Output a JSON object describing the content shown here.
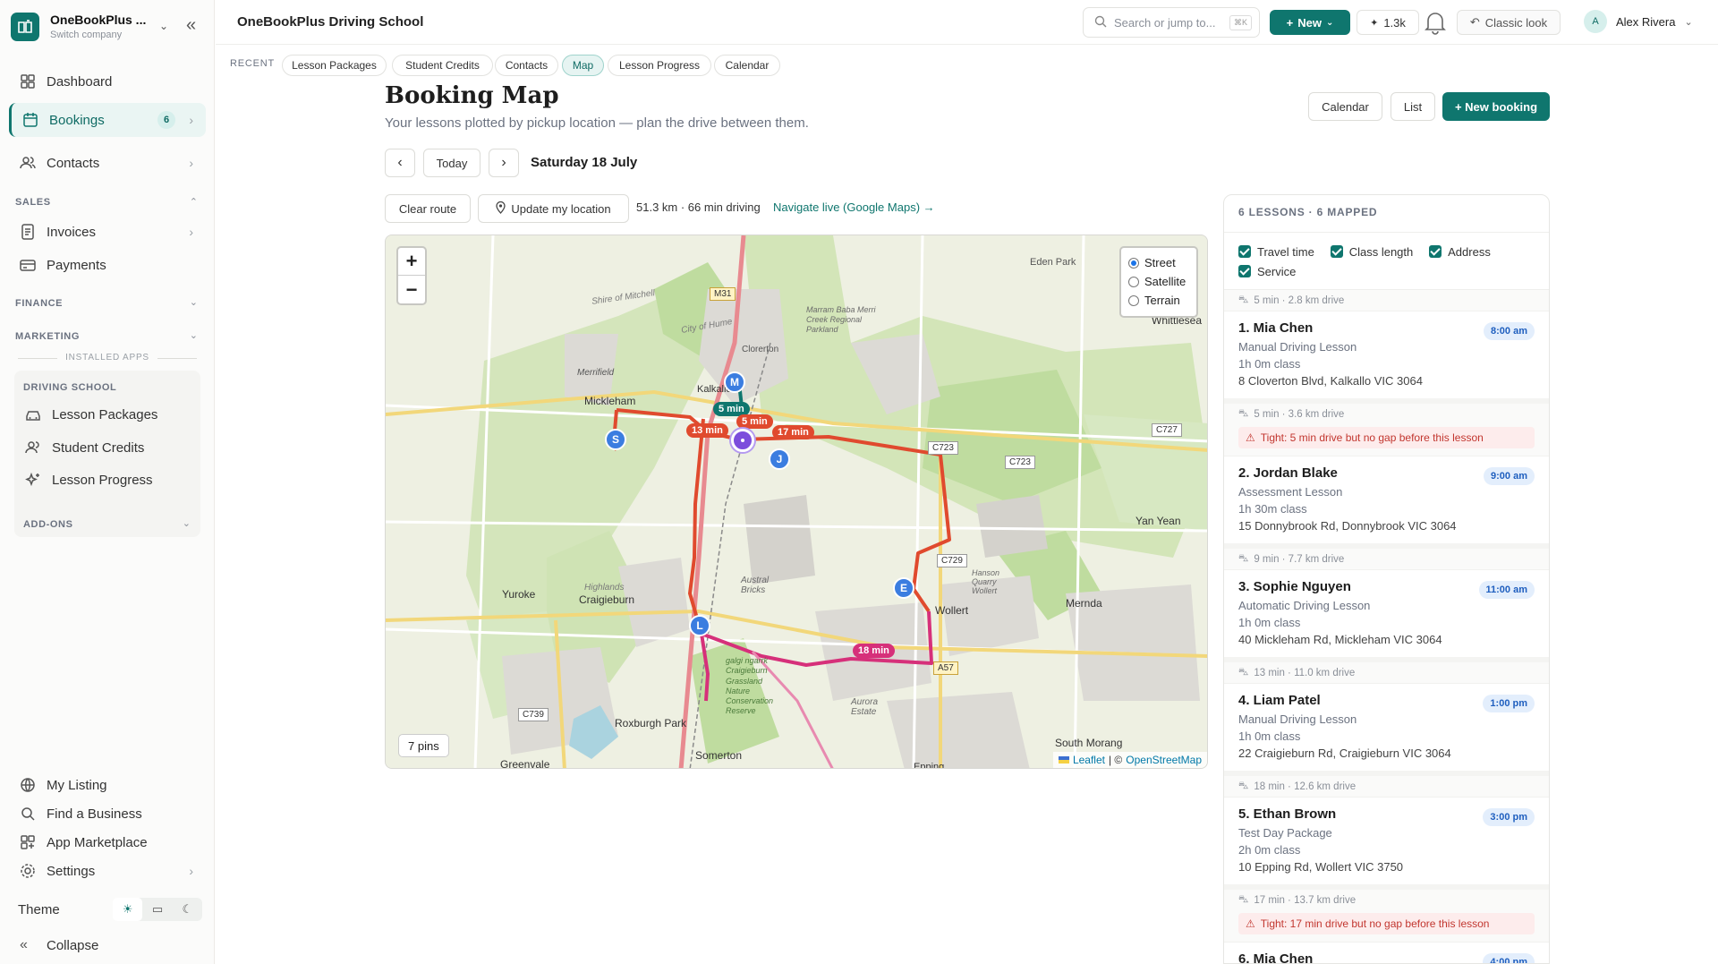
{
  "brand": {
    "name": "OneBookPlus ...",
    "sub": "Switch company"
  },
  "sidebar": {
    "dashboard": "Dashboard",
    "bookings": "Bookings",
    "bookings_count": "6",
    "contacts": "Contacts",
    "sales_header": "SALES",
    "invoices": "Invoices",
    "payments": "Payments",
    "finance_header": "FINANCE",
    "marketing_header": "MARKETING",
    "installed_apps": "INSTALLED APPS",
    "driving_school_header": "DRIVING SCHOOL",
    "lesson_packages": "Lesson Packages",
    "student_credits": "Student Credits",
    "lesson_progress": "Lesson Progress",
    "addons_header": "ADD-ONS",
    "my_listing": "My Listing",
    "find_business": "Find a Business",
    "app_marketplace": "App Marketplace",
    "settings": "Settings",
    "theme": "Theme",
    "collapse": "Collapse"
  },
  "topbar": {
    "title": "OneBookPlus Driving School",
    "search_placeholder": "Search or jump to...",
    "search_kbd": "⌘K",
    "new_label": "New",
    "credits_label": "1.3k",
    "classic_label": "Classic look",
    "user_initial": "A",
    "user_name": "Alex Rivera"
  },
  "recent": {
    "label": "RECENT",
    "chips": [
      "Lesson Packages",
      "Student Credits",
      "Contacts",
      "Map",
      "Lesson Progress",
      "Calendar"
    ],
    "active": "Map"
  },
  "page": {
    "title": "Booking Map",
    "subtitle": "Your lessons plotted by pickup location — plan the drive between them.",
    "calendar_btn": "Calendar",
    "list_btn": "List",
    "new_booking_btn": "+ New booking",
    "today_btn": "Today",
    "date": "Saturday 18 July",
    "clear_route": "Clear route",
    "update_location": "Update my location",
    "route_stats": "51.3 km · 66 min driving",
    "navigate_live": "Navigate live (Google Maps) →"
  },
  "map": {
    "layers": [
      "Street",
      "Satellite",
      "Terrain"
    ],
    "selected_layer": "Street",
    "pins_label": "7 pins",
    "attribution_leaflet": "Leaflet",
    "attribution_osm": "OpenStreetMap",
    "places": [
      "Eden Park",
      "Whittlesea",
      "Shire of Mitchell",
      "City of Hume",
      "Clorerton",
      "Marram Baba Merri Creek Regional Parkland",
      "Merrifield",
      "Kalkallo",
      "Mickleham",
      "Yan Yean",
      "Yuroke",
      "Craigieburn",
      "Highlands",
      "Austral Bricks",
      "Hanson Quarry Wollert",
      "Wollert",
      "Mernda",
      "Roxburgh Park",
      "Somerton",
      "Greenvale",
      "Aurora Estate",
      "South Morang",
      "Epping",
      "galgi ngarrk Craigieburn Grassland Nature Conservation Reserve"
    ],
    "roads": [
      "M31",
      "C723",
      "C723",
      "C727",
      "C729",
      "C739",
      "A57"
    ],
    "pins": [
      "M",
      "S",
      "J",
      "E",
      "L"
    ],
    "drive_labels": [
      "5 min",
      "13 min",
      "5 min",
      "17 min",
      "18 min"
    ]
  },
  "panel": {
    "header": "6 LESSONS · 6 MAPPED",
    "filters": [
      "Travel time",
      "Class length",
      "Address",
      "Service"
    ],
    "items": [
      {
        "drive": "5 min · 2.8 km drive",
        "warning": "",
        "name": "1. Mia Chen",
        "time": "8:00 am",
        "service": "Manual Driving Lesson",
        "length": "1h 0m class",
        "address": "8 Cloverton Blvd, Kalkallo VIC 3064"
      },
      {
        "drive": "5 min · 3.6 km drive",
        "warning": "Tight: 5 min drive but no gap before this lesson",
        "name": "2. Jordan Blake",
        "time": "9:00 am",
        "service": "Assessment Lesson",
        "length": "1h 30m class",
        "address": "15 Donnybrook Rd, Donnybrook VIC 3064"
      },
      {
        "drive": "9 min · 7.7 km drive",
        "warning": "",
        "name": "3. Sophie Nguyen",
        "time": "11:00 am",
        "service": "Automatic Driving Lesson",
        "length": "1h 0m class",
        "address": "40 Mickleham Rd, Mickleham VIC 3064"
      },
      {
        "drive": "13 min · 11.0 km drive",
        "warning": "",
        "name": "4. Liam Patel",
        "time": "1:00 pm",
        "service": "Manual Driving Lesson",
        "length": "1h 0m class",
        "address": "22 Craigieburn Rd, Craigieburn VIC 3064"
      },
      {
        "drive": "18 min · 12.6 km drive",
        "warning": "",
        "name": "5. Ethan Brown",
        "time": "3:00 pm",
        "service": "Test Day Package",
        "length": "2h 0m class",
        "address": "10 Epping Rd, Wollert VIC 3750"
      },
      {
        "drive": "17 min · 13.7 km drive",
        "warning": "Tight: 17 min drive but no gap before this lesson",
        "name": "6. Mia Chen",
        "time": "4:00 pm",
        "service": "",
        "length": "",
        "address": ""
      }
    ]
  }
}
